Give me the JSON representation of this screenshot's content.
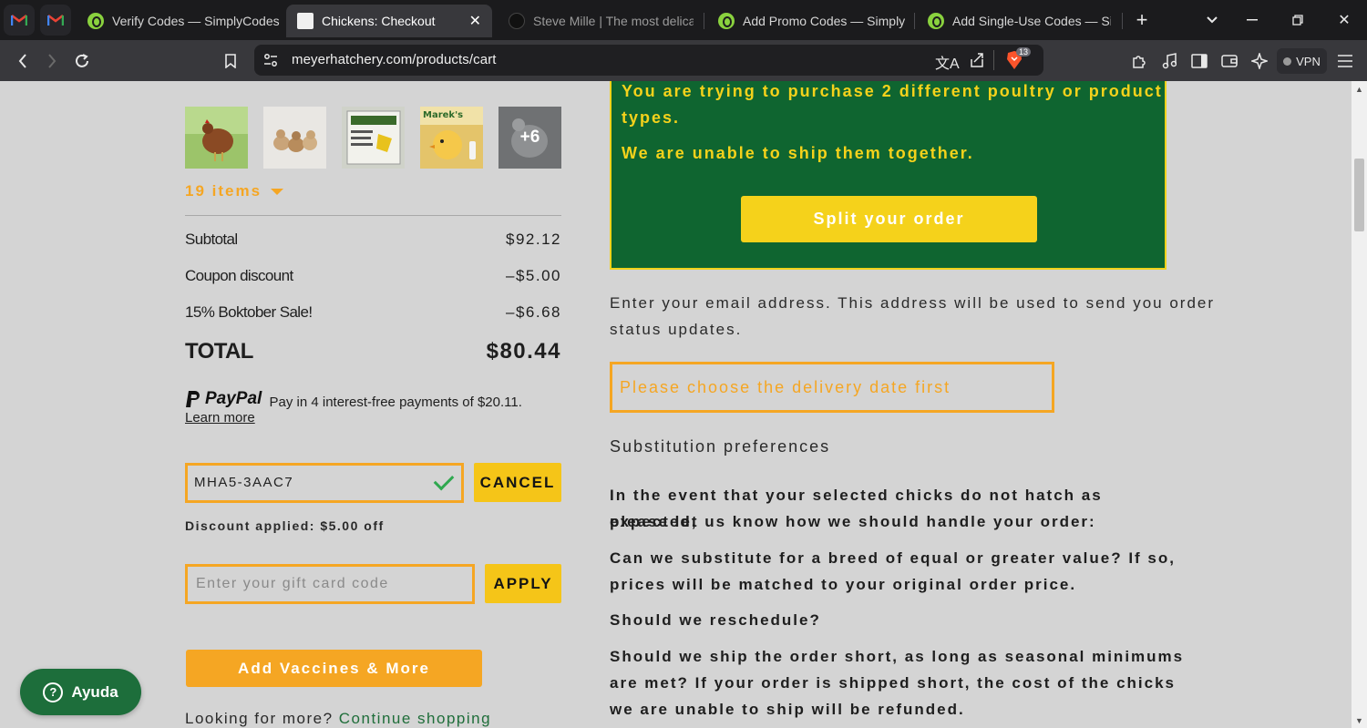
{
  "browser": {
    "tabs": [
      {
        "label": "Verify Codes — SimplyCodes",
        "active": false
      },
      {
        "label": "Chickens: Checkout",
        "active": true
      },
      {
        "label": "Steve Mille | The most delicate",
        "active": false
      },
      {
        "label": "Add Promo Codes — SimplyCo",
        "active": false
      },
      {
        "label": "Add Single-Use Codes — Simp",
        "active": false
      }
    ],
    "url": "meyerhatchery.com/products/cart",
    "vpn_label": "VPN",
    "shield_badge": "13"
  },
  "cart": {
    "thumb_more": "+6",
    "items_toggle": "19 items",
    "subtotal_label": "Subtotal",
    "subtotal_value": "$92.12",
    "coupon_label": "Coupon discount",
    "coupon_value": "–$5.00",
    "sale_label": "15% Boktober Sale!",
    "sale_value": "–$6.68",
    "total_label": "TOTAL",
    "total_value": "$80.44",
    "paypal_brand": "PayPal",
    "paypal_text": "Pay in 4 interest-free payments of $20.11.",
    "paypal_link": "Learn more",
    "coupon_code": "MHA5-3AAC7",
    "cancel_label": "CANCEL",
    "discount_note": "Discount applied: $5.00 off",
    "gift_placeholder": "Enter your gift card code",
    "apply_label": "APPLY",
    "vaccines_label": "Add Vaccines & More",
    "more_text": "Looking for more?",
    "continue_link": "Continue shopping"
  },
  "alert": {
    "line1": "You are trying to purchase 2 different poultry or product",
    "line2": "types.",
    "line3": "We are unable to ship them together.",
    "split_label": "Split your order"
  },
  "checkout": {
    "email_line1": "Enter your email address. This address will be used to send you order",
    "email_line2": "status updates.",
    "delivery_placeholder": "Please choose the delivery date first",
    "substitution_title": "Substitution preferences",
    "para1_line1": "In the event that your selected chicks do not hatch as expected,",
    "para1_line2": "please let us know how we should handle your order:",
    "para2_line1": "Can we substitute for a breed of equal or greater value? If so,",
    "para2_line2": "prices will be matched to your original order price.",
    "para3": "Should we reschedule?",
    "para4_line1": "Should we ship the order short, as long as seasonal minimums",
    "para4_line2": "are met? If your order is shipped short, the cost of the chicks",
    "para4_line3": "we are unable to ship will be refunded."
  },
  "help": {
    "label": "Ayuda"
  },
  "colors": {
    "accent_orange": "#f5a623",
    "accent_yellow": "#f5d21b",
    "alert_green": "#0f6530",
    "link_green": "#1f6e3a",
    "page_bg": "#d4d4d4"
  }
}
